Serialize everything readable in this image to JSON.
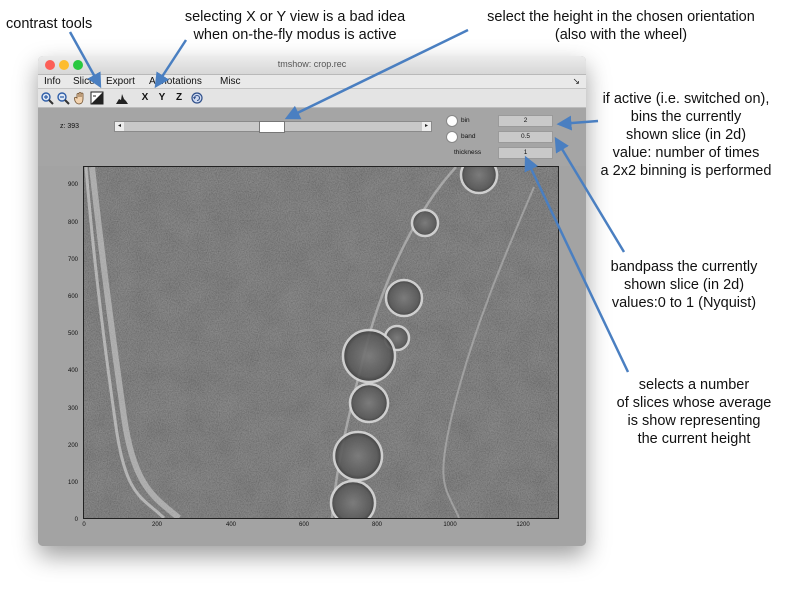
{
  "annotations": {
    "contrast_tools": "contrast tools",
    "xy_view_line1": "selecting X or Y view is a bad idea",
    "xy_view_line2": "when on-the-fly modus is active",
    "height_line1": "select the height in the chosen orientation",
    "height_line2": "(also with the wheel)",
    "bin_line1": "if active (i.e. switched on),",
    "bin_line2": "bins the currently",
    "bin_line3": "shown slice (in 2d)",
    "bin_line4": "value: number of times",
    "bin_line5": "a 2x2 binning is performed",
    "band_line1": "bandpass the currently",
    "band_line2": "shown slice (in 2d)",
    "band_line3": "values:0 to 1 (Nyquist)",
    "thick_line1": "selects a number",
    "thick_line2": "of slices whose average",
    "thick_line3": "is show representing",
    "thick_line4": "the current height"
  },
  "window": {
    "title": "tmshow: crop.rec",
    "traffic_colors": [
      "#fc5f57",
      "#fdbc2e",
      "#28c840"
    ],
    "menu": [
      "Info",
      "Slice",
      "Export",
      "Annotations",
      "Misc"
    ],
    "menu_corner": "↘",
    "toolbar": {
      "zoom_in": "zoom-in-icon",
      "zoom_out": "zoom-out-icon",
      "pan": "hand-icon",
      "contrast": "contrast-icon",
      "histogram": "histogram-icon",
      "view_x": "X",
      "view_y": "Y",
      "view_z": "Z",
      "rotate": "rotate-icon"
    }
  },
  "controls": {
    "z_label": "z: 393",
    "slider_left": "◂",
    "slider_right": "▸",
    "bin_label": "bin",
    "bin_value": "2",
    "band_label": "band",
    "band_value": "0.5",
    "thickness_label": "thickness",
    "thickness_value": "1"
  },
  "plot": {
    "y_ticks": [
      "900",
      "800",
      "700",
      "600",
      "500",
      "400",
      "300",
      "200",
      "100",
      "0"
    ],
    "x_ticks": [
      "0",
      "200",
      "400",
      "600",
      "800",
      "1000",
      "1200"
    ]
  }
}
